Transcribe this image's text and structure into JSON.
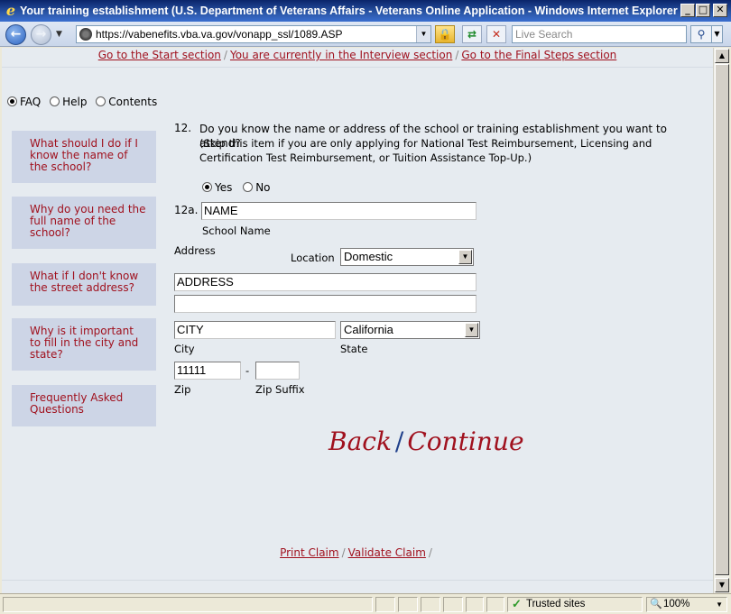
{
  "window": {
    "title": "Your training establishment (U.S. Department of Veterans Affairs - Veterans Online Application  - Windows Internet Explorer",
    "minimize": "_",
    "maximize": "□",
    "close": "✕"
  },
  "browser": {
    "url": "https://vabenefits.vba.va.gov/vonapp_ssl/1089.ASP",
    "search_placeholder": "Live Search"
  },
  "breadcrumbs": {
    "start": "Go to the Start section",
    "current": "You are currently in the Interview section",
    "final": "Go to the Final Steps section",
    "separator": "/"
  },
  "help_tabs": {
    "faq": "FAQ",
    "help": "Help",
    "contents": "Contents",
    "selected": "FAQ"
  },
  "sidebar": {
    "items": [
      {
        "label": "What should I do if I know the name of the school?"
      },
      {
        "label": "Why do you need the full name of the school?"
      },
      {
        "label": "What if I don't know the street address?"
      },
      {
        "label": "Why is it important to fill in the city and state?"
      },
      {
        "label": "Frequently Asked Questions"
      }
    ]
  },
  "question": {
    "number": "12.",
    "text": "Do you know the name or address of the school or training establishment you want to attend?",
    "note": "(Skip this item if you are only applying for National Test Reimbursement, Licensing and Certification Test Reimbursement, or Tuition Assistance Top-Up.)",
    "yes_label": "Yes",
    "no_label": "No",
    "selected": "Yes"
  },
  "form": {
    "sub_number": "12a.",
    "school_name_value": "NAME",
    "school_name_label": "School Name",
    "address_label": "Address",
    "location_label": "Location",
    "location_value": "Domestic",
    "address1_value": "ADDRESS",
    "address2_value": "",
    "city_value": "CITY",
    "city_label": "City",
    "state_value": "California",
    "state_label": "State",
    "zip_value": "11111",
    "zip_label": "Zip",
    "zip_dash": "-",
    "zip_suffix_value": "",
    "zip_suffix_label": "Zip Suffix"
  },
  "actions": {
    "back": "Back",
    "slash": "/",
    "continue": "Continue"
  },
  "footer": {
    "print": "Print Claim",
    "validate": "Validate Claim",
    "separator": "/"
  },
  "statusbar": {
    "zone": "Trusted sites",
    "zoom": "100%"
  }
}
